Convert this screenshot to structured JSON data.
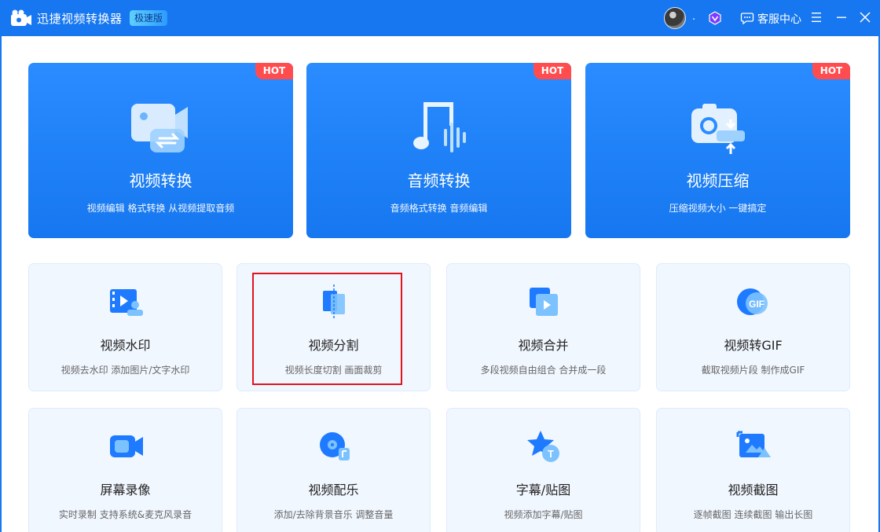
{
  "app": {
    "title": "迅捷视频转换器",
    "edition": "极速版",
    "username": ".",
    "support_label": "客服中心"
  },
  "colors": {
    "brand_blue": "#1677f0",
    "hot_red": "#ff4d4f",
    "card_bg": "#f1f7ff",
    "highlight_red": "#e0141e"
  },
  "big_cards": [
    {
      "title": "视频转换",
      "desc": "视频编辑 格式转换 从视频提取音频",
      "badge": "HOT",
      "icon": "video-convert-icon"
    },
    {
      "title": "音频转换",
      "desc": "音频格式转换 音频编辑",
      "badge": "HOT",
      "icon": "audio-convert-icon"
    },
    {
      "title": "视频压缩",
      "desc": "压缩视频大小 一键搞定",
      "badge": "HOT",
      "icon": "video-compress-icon"
    }
  ],
  "small_cards": [
    {
      "title": "视频水印",
      "desc": "视频去水印 添加图片/文字水印",
      "icon": "watermark-icon"
    },
    {
      "title": "视频分割",
      "desc": "视频长度切割 画面裁剪",
      "icon": "split-icon"
    },
    {
      "title": "视频合并",
      "desc": "多段视频自由组合 合并成一段",
      "icon": "merge-icon"
    },
    {
      "title": "视频转GIF",
      "desc": "截取视频片段 制作成GIF",
      "icon": "gif-icon",
      "icon_text": "GIF"
    },
    {
      "title": "屏幕录像",
      "desc": "实时录制 支持系统&麦克风录音",
      "icon": "screen-record-icon"
    },
    {
      "title": "视频配乐",
      "desc": "添加/去除背景音乐 调整音量",
      "icon": "music-disc-icon"
    },
    {
      "title": "字幕/贴图",
      "desc": "视频添加字幕/贴图",
      "icon": "subtitle-star-icon",
      "icon_text": "T"
    },
    {
      "title": "视频截图",
      "desc": "逐帧截图 连续截图 输出长图",
      "icon": "screenshot-icon"
    }
  ]
}
